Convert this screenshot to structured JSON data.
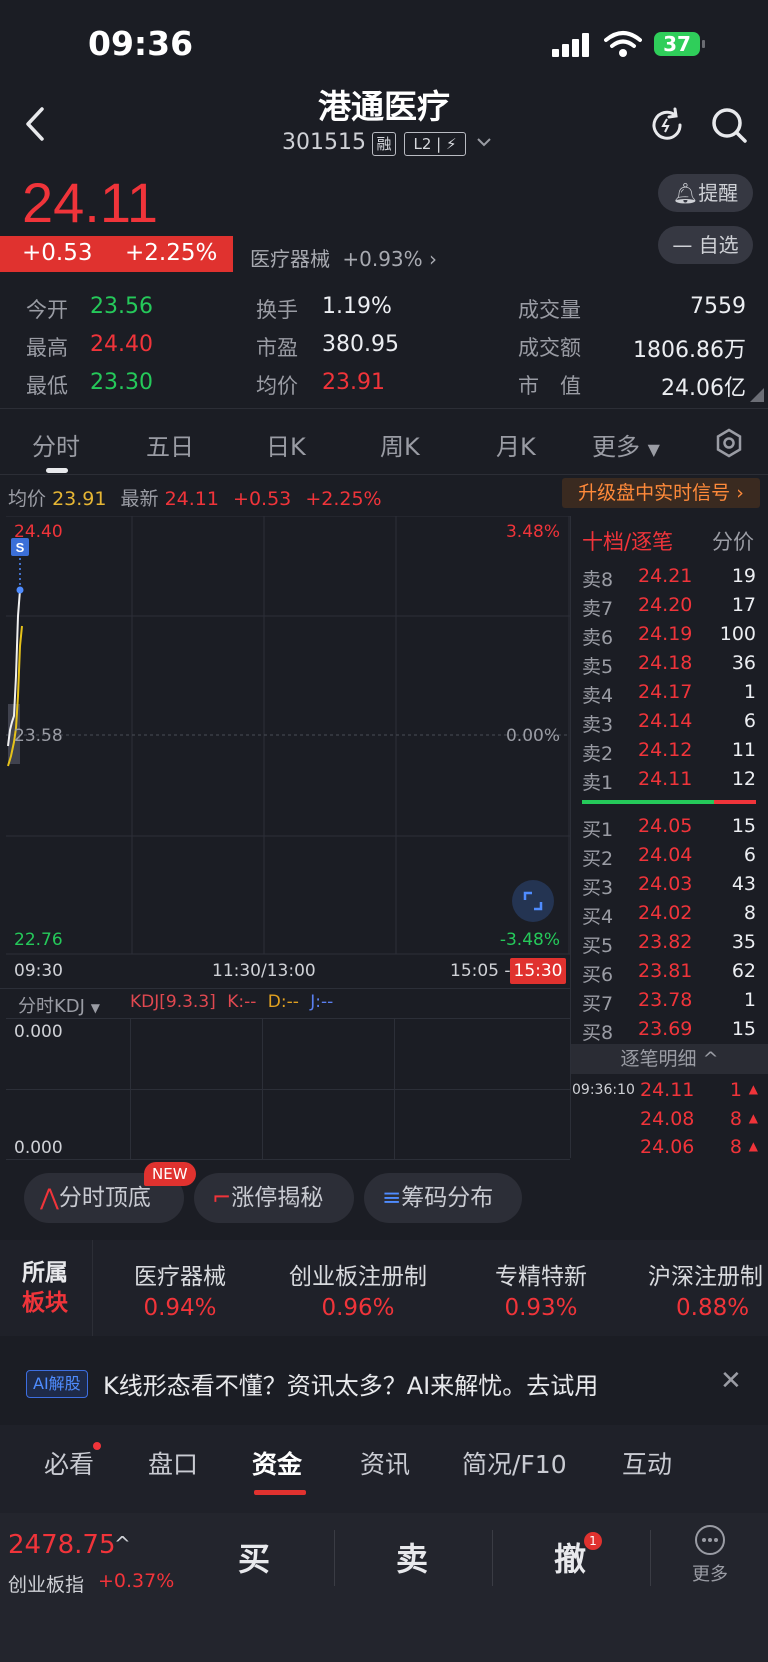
{
  "status_bar": {
    "time": "09:36",
    "battery": "37"
  },
  "header": {
    "title": "港通医疗",
    "code": "301515",
    "margin_tag": "融",
    "level_tag": "L2",
    "refresh_icon": "refresh-icon",
    "search_icon": "search-icon"
  },
  "quote": {
    "price": "24.11",
    "change": "+0.53",
    "change_pct": "+2.25%",
    "sector": "医疗器械",
    "sector_change": "+0.93%",
    "alert_label": "提醒",
    "watchlist_label": "自选"
  },
  "stats": {
    "open_label": "今开",
    "open": "23.56",
    "high_label": "最高",
    "high": "24.40",
    "low_label": "最低",
    "low": "23.30",
    "turnover_label": "换手",
    "turnover": "1.19%",
    "pe_label": "市盈",
    "pe": "380.95",
    "avg_label": "均价",
    "avg": "23.91",
    "volume_label": "成交量",
    "volume": "7559",
    "amount_label": "成交额",
    "amount": "1806.86万",
    "mcap_label": "市　值",
    "mcap": "24.06亿"
  },
  "kline_tabs": [
    "分时",
    "五日",
    "日K",
    "周K",
    "月K",
    "更多"
  ],
  "info_row": {
    "avg_label": "均价",
    "avg": "23.91",
    "last_label": "最新",
    "last": "24.11",
    "change": "+0.53",
    "change_pct": "+2.25%",
    "upgrade": "升级盘中实时信号"
  },
  "chart": {
    "top_price": "24.40",
    "mid_price": "23.58",
    "bottom_price": "22.76",
    "top_pct": "3.48%",
    "mid_pct": "0.00%",
    "bottom_pct": "-3.48%",
    "t_start": "09:30",
    "t_mid": "11:30/13:00",
    "t_end_left": "15:05 -",
    "t_end": "15:30",
    "marker": "S",
    "indicator_name": "分时KDJ",
    "kdj_params": "KDJ[9.3.3]",
    "k": "K:--",
    "d": "D:--",
    "j": "J:--",
    "ind_top": "0.000",
    "ind_bottom": "0.000"
  },
  "order_book": {
    "tab_active": "十档/逐笔",
    "tab_other": "分价",
    "asks": [
      {
        "label": "卖8",
        "price": "24.21",
        "vol": "19"
      },
      {
        "label": "卖7",
        "price": "24.20",
        "vol": "17"
      },
      {
        "label": "卖6",
        "price": "24.19",
        "vol": "100"
      },
      {
        "label": "卖5",
        "price": "24.18",
        "vol": "36"
      },
      {
        "label": "卖4",
        "price": "24.17",
        "vol": "1"
      },
      {
        "label": "卖3",
        "price": "24.14",
        "vol": "6"
      },
      {
        "label": "卖2",
        "price": "24.12",
        "vol": "11"
      },
      {
        "label": "卖1",
        "price": "24.11",
        "vol": "12"
      }
    ],
    "bids": [
      {
        "label": "买1",
        "price": "24.05",
        "vol": "15"
      },
      {
        "label": "买2",
        "price": "24.04",
        "vol": "6"
      },
      {
        "label": "买3",
        "price": "24.03",
        "vol": "43"
      },
      {
        "label": "买4",
        "price": "24.02",
        "vol": "8"
      },
      {
        "label": "买5",
        "price": "23.82",
        "vol": "35"
      },
      {
        "label": "买6",
        "price": "23.81",
        "vol": "62"
      },
      {
        "label": "买7",
        "price": "23.78",
        "vol": "1"
      },
      {
        "label": "买8",
        "price": "23.69",
        "vol": "15"
      }
    ],
    "ticks_title": "逐笔明细",
    "ticks": [
      {
        "time": "09:36:10",
        "price": "24.11",
        "vol": "1"
      },
      {
        "time": "",
        "price": "24.08",
        "vol": "8"
      },
      {
        "time": "",
        "price": "24.06",
        "vol": "8"
      }
    ]
  },
  "features": {
    "new_badge": "NEW",
    "items": [
      "分时顶底",
      "涨停揭秘",
      "筹码分布"
    ]
  },
  "sectors": {
    "title_top": "所属",
    "title_bottom": "板块",
    "items": [
      {
        "name": "医疗器械",
        "change": "0.94%"
      },
      {
        "name": "创业板注册制",
        "change": "0.96%"
      },
      {
        "name": "专精特新",
        "change": "0.93%"
      },
      {
        "name": "沪深注册制",
        "change": "0.88%"
      }
    ]
  },
  "ai_banner": {
    "tag": "AI解股",
    "text": "K线形态看不懂？资讯太多？AI来解忧。去试用"
  },
  "bottom_tabs": [
    "必看",
    "盘口",
    "资金",
    "资讯",
    "简况/F10",
    "互动"
  ],
  "footer": {
    "index_value": "2478.75",
    "index_name": "创业板指",
    "index_change": "+0.37%",
    "buy": "买",
    "sell": "卖",
    "cancel": "撤",
    "cancel_badge": "1",
    "more": "更多"
  },
  "colors": {
    "up": "#f0343a",
    "down": "#25c95a",
    "background": "#1b1d24"
  }
}
